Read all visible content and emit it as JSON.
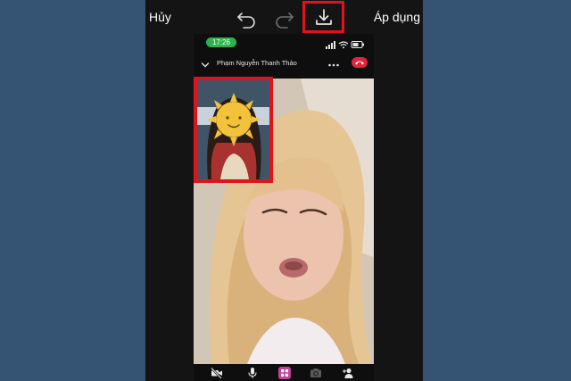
{
  "toolbar": {
    "cancel_label": "Hủy",
    "apply_label": "Áp dụng",
    "icons": [
      "undo-icon",
      "redo-icon",
      "download-icon"
    ],
    "highlight_color": "#e0121a"
  },
  "phone": {
    "status_time": "17:26",
    "caller_name": "Phạm Nguyễn Thanh Thảo",
    "controls": [
      "video-off-icon",
      "mic-icon",
      "effects-icon",
      "camera-switch-icon",
      "add-person-icon"
    ],
    "end_call_color": "#e2233a"
  },
  "colors": {
    "background": "#355474",
    "editor_bg": "#141414",
    "status_pill": "#2db34a"
  }
}
